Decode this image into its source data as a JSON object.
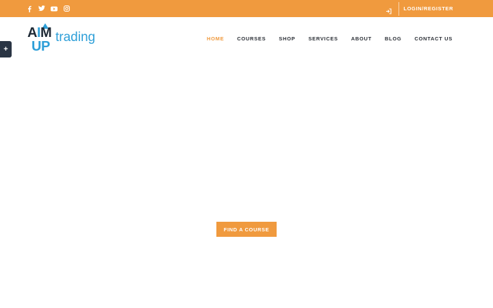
{
  "topbar": {
    "social_icons": [
      "facebook-icon",
      "twitter-icon",
      "youtube-icon",
      "instagram-icon"
    ],
    "login_icon": "sign-in-icon",
    "login_label": "LOGIN/REGISTER"
  },
  "logo": {
    "line1_start": "A",
    "line1_accent": "I",
    "line1_end": "M",
    "line2": "UP",
    "word": "trading"
  },
  "nav": {
    "items": [
      {
        "label": "HOME",
        "active": true
      },
      {
        "label": "COURSES"
      },
      {
        "label": "SHOP"
      },
      {
        "label": "SERVICES"
      },
      {
        "label": "ABOUT"
      },
      {
        "label": "BLOG"
      },
      {
        "label": "CONTACT US"
      }
    ]
  },
  "side_toggle": {
    "symbol": "+"
  },
  "hero": {
    "cta_label": "FIND A COURSE"
  },
  "colors": {
    "accent": "#f09a3e",
    "brand_blue": "#2e9fd8",
    "dark": "#1f2a36",
    "side_toggle_bg": "#2a3544"
  }
}
